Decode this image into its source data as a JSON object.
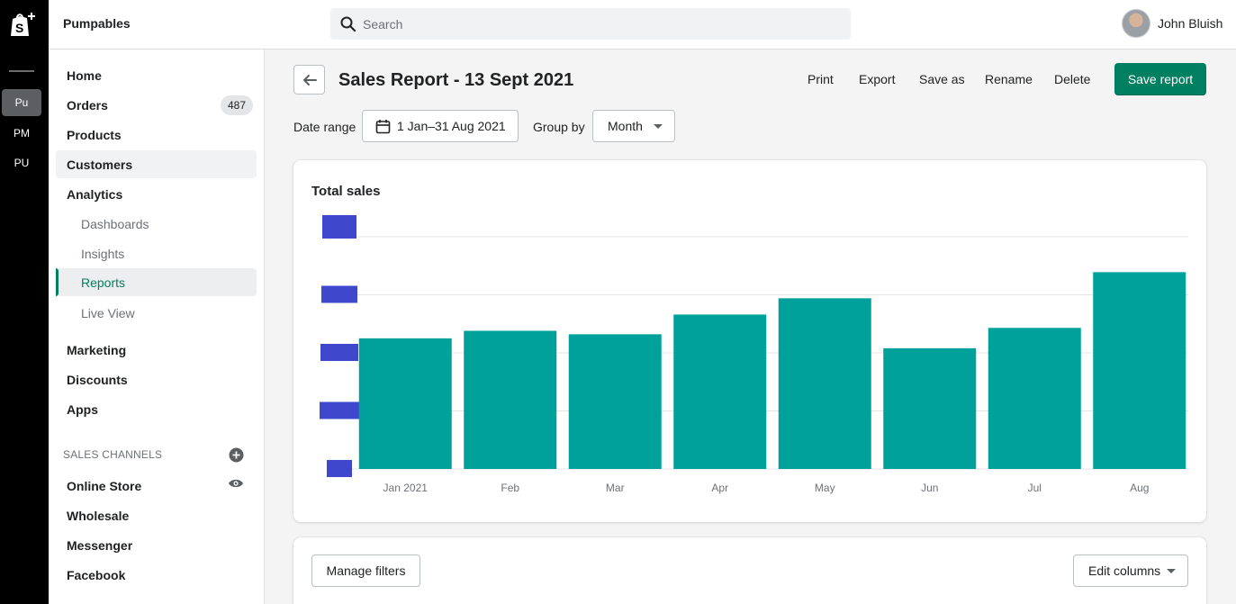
{
  "rail": {
    "stores": [
      "Pu",
      "PM",
      "PU"
    ]
  },
  "header": {
    "store_name": "Pumpables",
    "search_placeholder": "Search",
    "user_name": "John Bluish"
  },
  "sidebar": {
    "items": [
      {
        "label": "Home"
      },
      {
        "label": "Orders",
        "badge": "487"
      },
      {
        "label": "Products"
      },
      {
        "label": "Customers"
      },
      {
        "label": "Analytics"
      },
      {
        "label": "Dashboards"
      },
      {
        "label": "Insights"
      },
      {
        "label": "Reports"
      },
      {
        "label": "Live View"
      },
      {
        "label": "Marketing"
      },
      {
        "label": "Discounts"
      },
      {
        "label": "Apps"
      }
    ],
    "sales_channels_title": "SALES CHANNELS",
    "channels": [
      {
        "label": "Online Store"
      },
      {
        "label": "Wholesale"
      },
      {
        "label": "Messenger"
      },
      {
        "label": "Facebook"
      }
    ]
  },
  "page": {
    "title": "Sales Report - 13 Sept 2021",
    "actions": [
      "Print",
      "Export",
      "Save as",
      "Rename",
      "Delete"
    ],
    "save_label": "Save report",
    "date_range_label": "Date range",
    "date_range_value": "1 Jan–31 Aug 2021",
    "group_by_label": "Group by",
    "group_by_value": "Month"
  },
  "chart_data": {
    "type": "bar",
    "title": "Total sales",
    "categories": [
      "Jan 2021",
      "Feb",
      "Mar",
      "Apr",
      "May",
      "Jun",
      "Jul",
      "Aug"
    ],
    "values": [
      2.25,
      2.38,
      2.32,
      2.66,
      2.94,
      2.08,
      2.43,
      3.39
    ],
    "ylim": [
      0,
      4
    ],
    "y_tick_count": 5,
    "bar_color": "#00a19b",
    "ytick_redacted_color": "#3f48cc",
    "grid": true
  },
  "filters": {
    "manage_label": "Manage filters",
    "edit_columns_label": "Edit columns"
  }
}
